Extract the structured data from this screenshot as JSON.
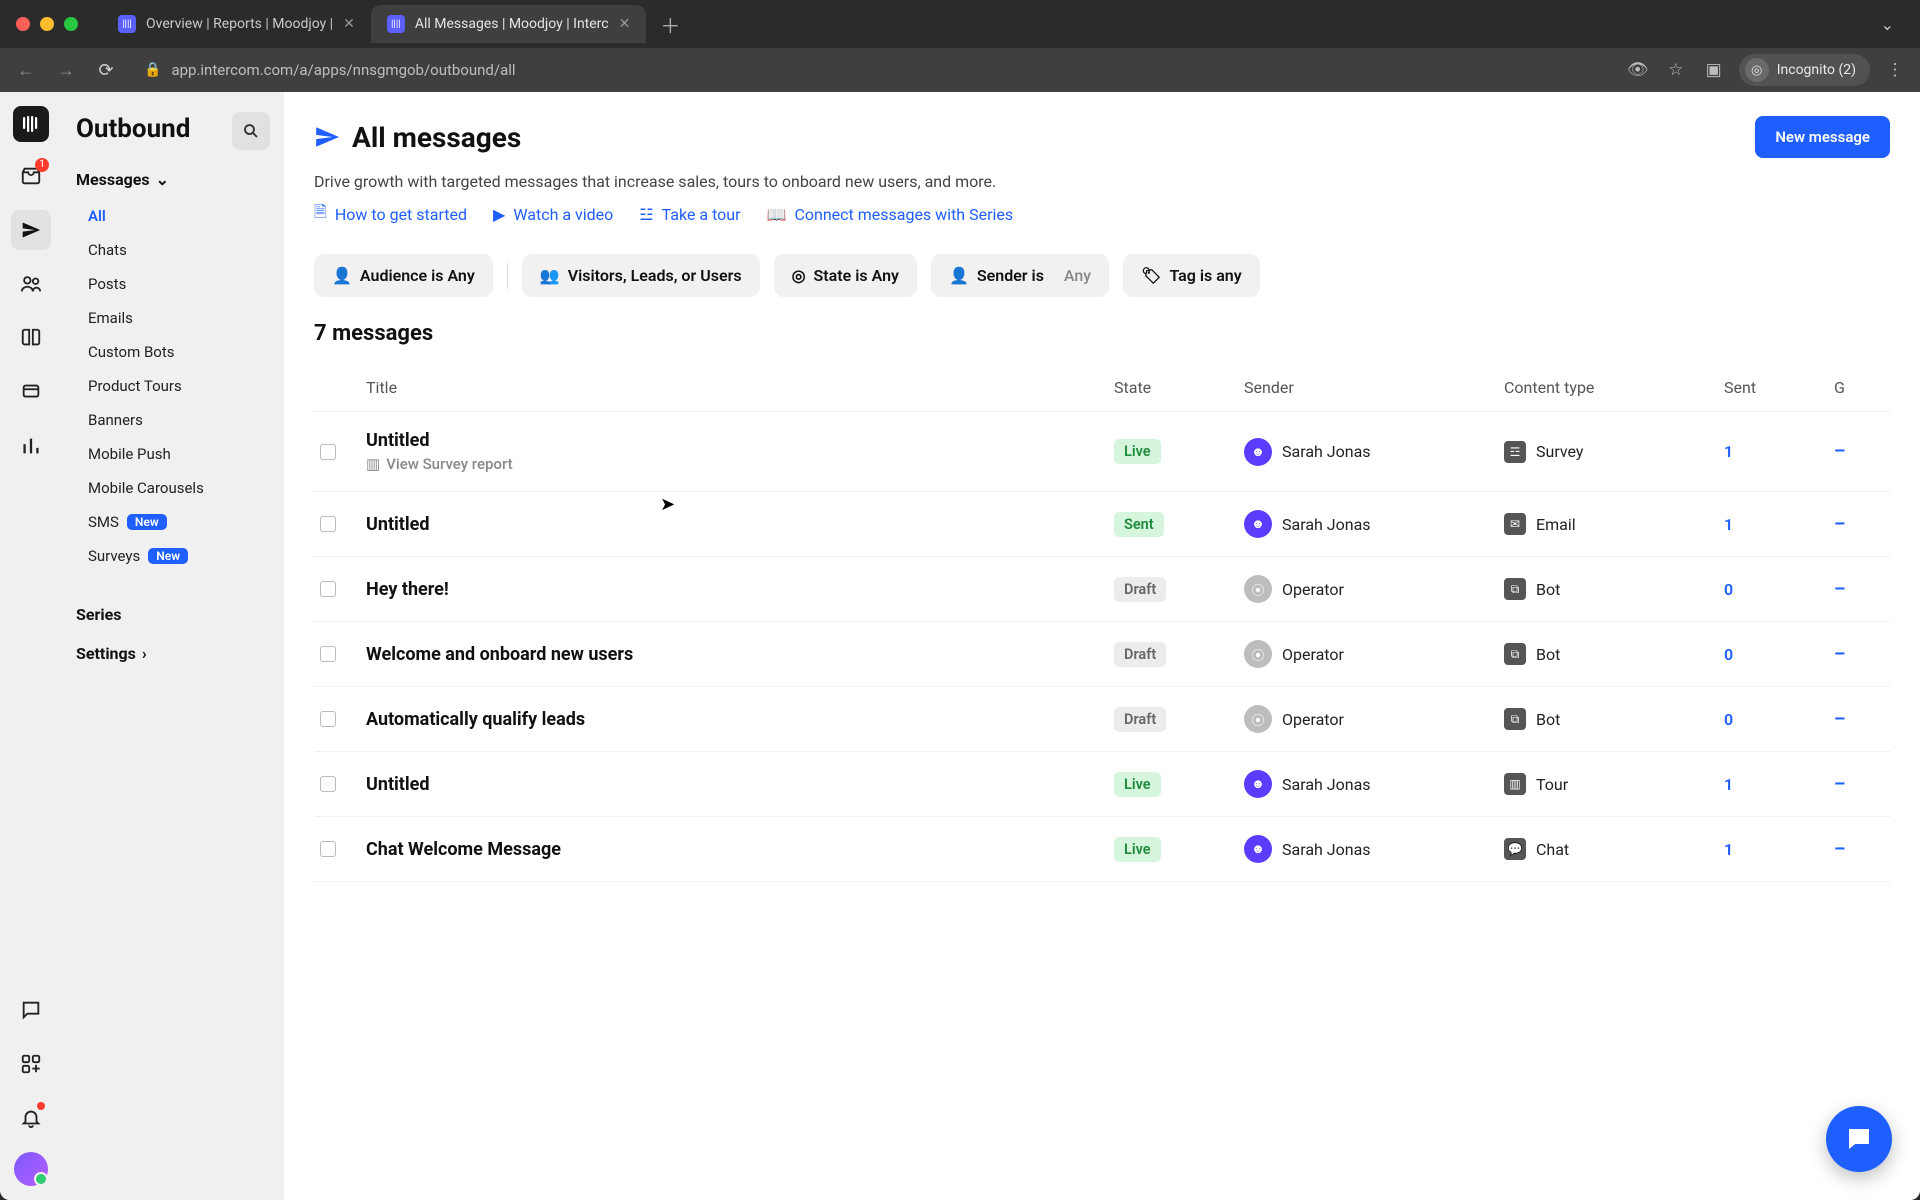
{
  "browser": {
    "tabs": [
      {
        "label": "Overview | Reports | Moodjoy |",
        "active": false
      },
      {
        "label": "All Messages | Moodjoy | Interc",
        "active": true
      }
    ],
    "url": "app.intercom.com/a/apps/nnsgmgob/outbound/all",
    "incognito_label": "Incognito (2)"
  },
  "rail": {
    "inbox_badge": "1"
  },
  "sidebar": {
    "title": "Outbound",
    "messages_label": "Messages",
    "items": [
      {
        "label": "All",
        "active": true
      },
      {
        "label": "Chats"
      },
      {
        "label": "Posts"
      },
      {
        "label": "Emails"
      },
      {
        "label": "Custom Bots"
      },
      {
        "label": "Product Tours"
      },
      {
        "label": "Banners"
      },
      {
        "label": "Mobile Push"
      },
      {
        "label": "Mobile Carousels"
      },
      {
        "label": "SMS",
        "pill": "New"
      },
      {
        "label": "Surveys",
        "pill": "New"
      }
    ],
    "series_label": "Series",
    "settings_label": "Settings"
  },
  "page": {
    "title": "All messages",
    "description": "Drive growth with targeted messages that increase sales, tours to onboard new users, and more.",
    "help": {
      "how": "How to get started",
      "video": "Watch a video",
      "tour": "Take a tour",
      "series": "Connect messages with Series"
    },
    "primary_button": "New message",
    "filters": {
      "audience": "Audience is Any",
      "visitors": "Visitors, Leads, or Users",
      "state": "State is Any",
      "sender_label": "Sender is",
      "sender_value": "Any",
      "tag": "Tag is any"
    },
    "count_label": "7 messages",
    "columns": {
      "title": "Title",
      "state": "State",
      "sender": "Sender",
      "content": "Content type",
      "sent": "Sent",
      "g": "G"
    },
    "rows": [
      {
        "title": "Untitled",
        "sub": "View Survey report",
        "state": "Live",
        "state_cls": "st-live",
        "sender": "Sarah Jonas",
        "sender_kind": "user",
        "ctype": "Survey",
        "sent": "1",
        "g": "–"
      },
      {
        "title": "Untitled",
        "state": "Sent",
        "state_cls": "st-sent",
        "sender": "Sarah Jonas",
        "sender_kind": "user",
        "ctype": "Email",
        "sent": "1",
        "g": "–"
      },
      {
        "title": "Hey there!",
        "state": "Draft",
        "state_cls": "st-draft",
        "sender": "Operator",
        "sender_kind": "op",
        "ctype": "Bot",
        "sent": "0",
        "g": "–"
      },
      {
        "title": "Welcome and onboard new users",
        "state": "Draft",
        "state_cls": "st-draft",
        "sender": "Operator",
        "sender_kind": "op",
        "ctype": "Bot",
        "sent": "0",
        "g": "–"
      },
      {
        "title": "Automatically qualify leads",
        "state": "Draft",
        "state_cls": "st-draft",
        "sender": "Operator",
        "sender_kind": "op",
        "ctype": "Bot",
        "sent": "0",
        "g": "–"
      },
      {
        "title": "Untitled",
        "state": "Live",
        "state_cls": "st-live",
        "sender": "Sarah Jonas",
        "sender_kind": "user",
        "ctype": "Tour",
        "sent": "1",
        "g": "–"
      },
      {
        "title": "Chat Welcome Message",
        "state": "Live",
        "state_cls": "st-live",
        "sender": "Sarah Jonas",
        "sender_kind": "user",
        "ctype": "Chat",
        "sent": "1",
        "g": "–"
      }
    ]
  }
}
